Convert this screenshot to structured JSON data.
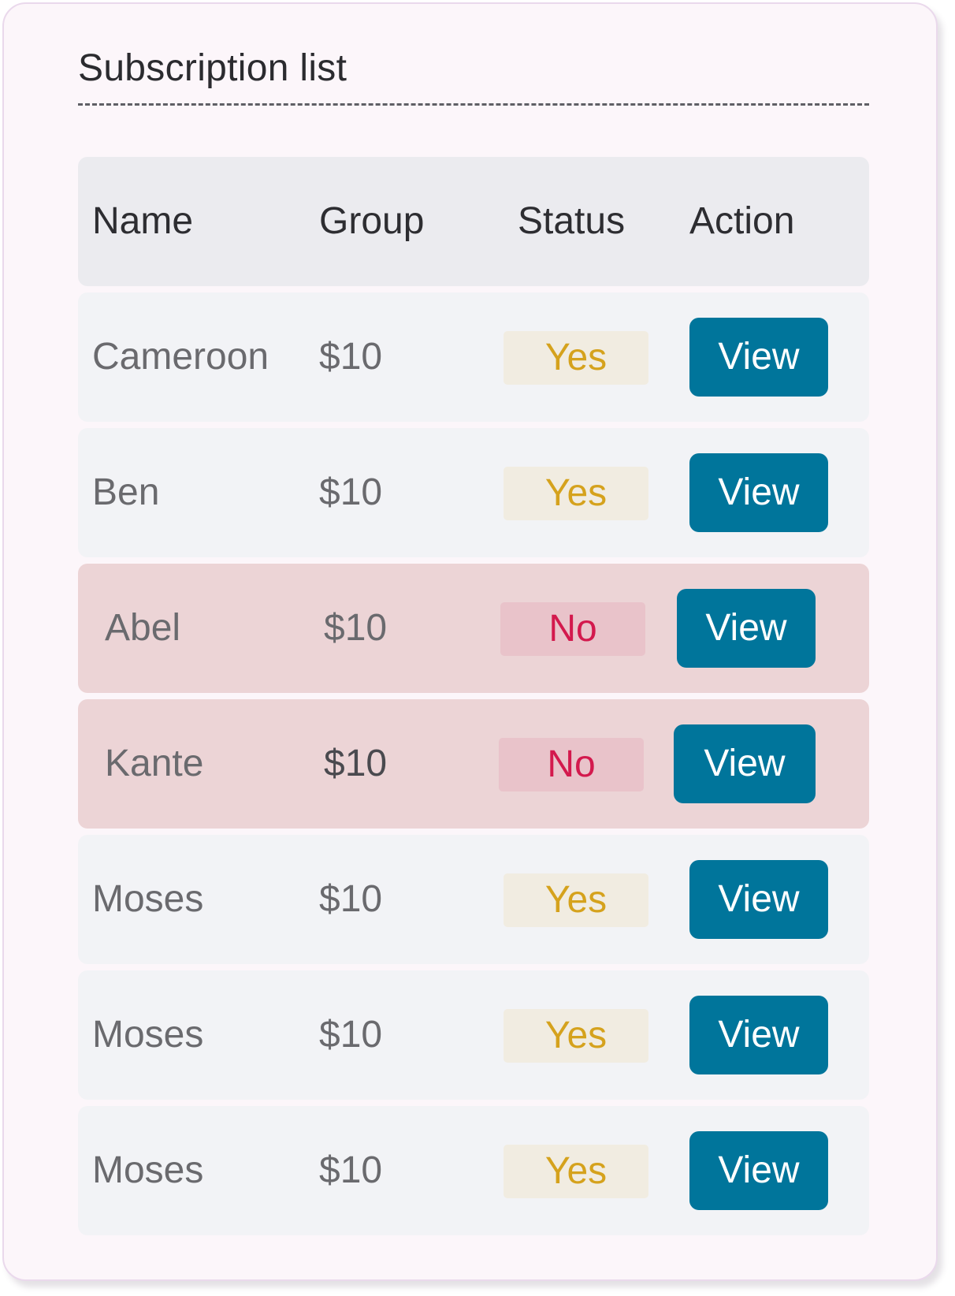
{
  "card": {
    "title": "Subscription list"
  },
  "table": {
    "headers": {
      "name": "Name",
      "group": "Group",
      "status": "Status",
      "action": "Action"
    },
    "rows": [
      {
        "name": "Cameroon",
        "group": "$10",
        "status": "Yes",
        "action": "View"
      },
      {
        "name": "Ben",
        "group": "$10",
        "status": "Yes",
        "action": "View"
      },
      {
        "name": "Abel",
        "group": "$10",
        "status": "No",
        "action": "View"
      },
      {
        "name": "Kante",
        "group": "$10",
        "status": "No",
        "action": "View"
      },
      {
        "name": "Moses",
        "group": "$10",
        "status": "Yes",
        "action": "View"
      },
      {
        "name": "Moses",
        "group": "$10",
        "status": "Yes",
        "action": "View"
      },
      {
        "name": "Moses",
        "group": "$10",
        "status": "Yes",
        "action": "View"
      }
    ]
  },
  "colors": {
    "card_background": "#fcf6fa",
    "card_border": "#ead9ec",
    "header_background": "#ebebef",
    "row_background": "#f2f3f6",
    "row_negative_background": "#ecd4d6",
    "status_yes_background": "#f1ece1",
    "status_yes_text": "#d5a21d",
    "status_no_background": "#e9c3ca",
    "status_no_text": "#d3194d",
    "button_background": "#00759b",
    "button_text": "#ffffff"
  }
}
